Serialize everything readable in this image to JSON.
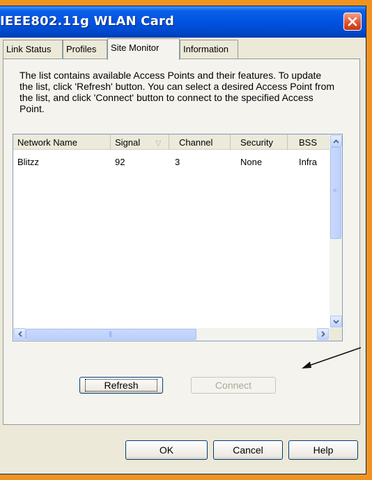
{
  "window": {
    "title": "IEEE802.11g WLAN Card"
  },
  "tabs": [
    {
      "label": "Link Status"
    },
    {
      "label": "Profiles"
    },
    {
      "label": "Site Monitor"
    },
    {
      "label": "Information"
    }
  ],
  "active_tab": "Site Monitor",
  "site_monitor": {
    "description": "The list contains available Access Points and their features. To update the list, click 'Refresh' button. You can select a desired Access Point from the list, and click 'Connect' button to connect to the specified Access Point.",
    "columns": [
      "Network Name",
      "Signal",
      "Channel",
      "Security",
      "BSS"
    ],
    "rows": [
      {
        "network_name": "Blitzz",
        "signal": "92",
        "channel": "3",
        "security": "None",
        "bss": "Infra"
      }
    ],
    "refresh_label": "Refresh",
    "connect_label": "Connect"
  },
  "dialog_buttons": {
    "ok": "OK",
    "cancel": "Cancel",
    "help": "Help"
  },
  "colors": {
    "titlebar": "#0053e1",
    "frame_border": "#f0941f",
    "close_button": "#e0502a"
  },
  "icons": [
    "close-icon",
    "sort-arrow-icon",
    "scroll-up-icon",
    "scroll-down-icon",
    "scroll-left-icon",
    "scroll-right-icon",
    "pointer-arrow-icon"
  ]
}
